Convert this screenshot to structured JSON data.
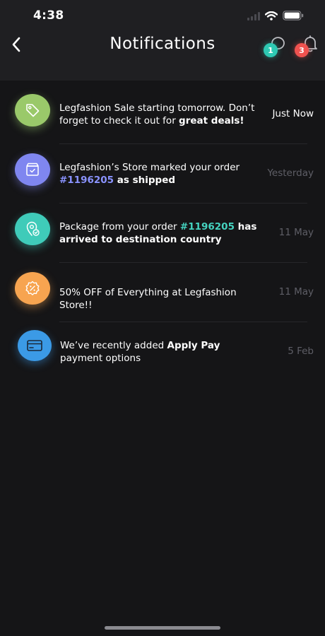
{
  "status_bar": {
    "time": "4:38"
  },
  "header": {
    "title": "Notifications",
    "messages_badge": "1",
    "alerts_badge": "3"
  },
  "notifications": [
    {
      "icon": "tag-icon",
      "color": "#9ac96a",
      "text_a": "Legfashion Sale starting tomorrow. Don’t forget to check it out for ",
      "bold": "great deals!",
      "time": "Just Now"
    },
    {
      "icon": "package-check-icon",
      "color": "#7f86f0",
      "text_a": "Legfashion’s Store marked your order ",
      "order": "#1196205",
      "bold": " as shipped",
      "time": "Yesterday"
    },
    {
      "icon": "location-check-icon",
      "color": "#3fcbb9",
      "text_a": "Package from your order ",
      "order": "#1196205",
      "bold": " has arrived to destination country",
      "time": "11 May"
    },
    {
      "icon": "discount-badge-icon",
      "color": "#f7a450",
      "text_a": "50% OFF of Everything at Legfashion Store!!",
      "time": "11 May"
    },
    {
      "icon": "credit-card-icon",
      "color": "#3b9ae6",
      "text_a": "We’ve recently added ",
      "bold": "Apply Pay",
      "text_b": " payment options",
      "time": "5 Feb"
    }
  ]
}
